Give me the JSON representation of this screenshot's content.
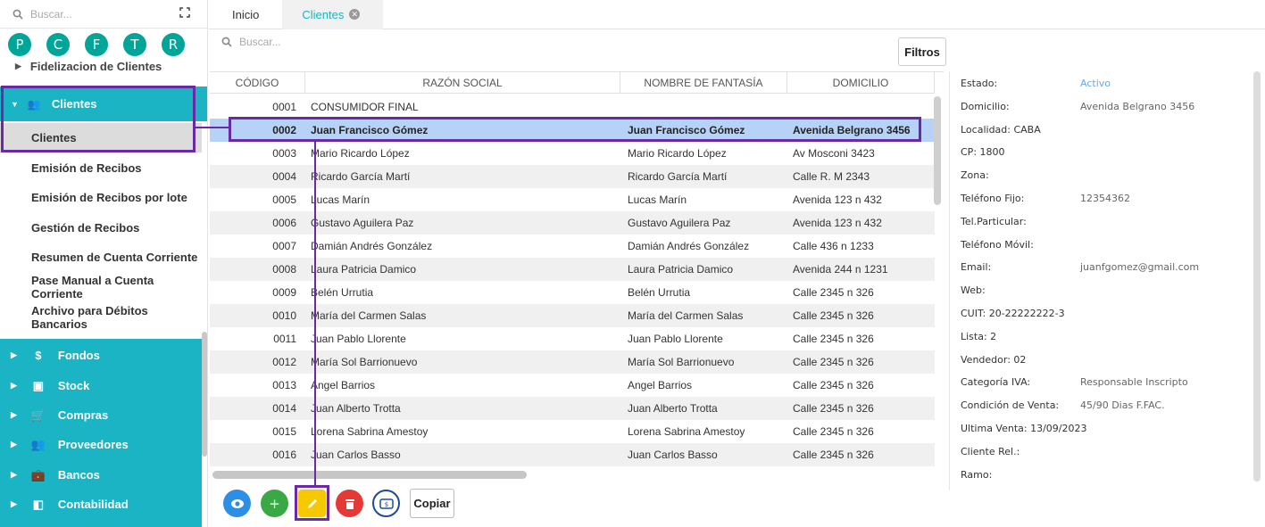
{
  "sidebar": {
    "search_placeholder": "Buscar...",
    "avatars": [
      "P",
      "C",
      "F",
      "T",
      "R"
    ],
    "above_item": "Fidelizacion de Clientes",
    "section": "Clientes",
    "sub_items": [
      "Clientes",
      "Emisión de Recibos",
      "Emisión de Recibos por lote",
      "Gestión de Recibos",
      "Resumen de Cuenta Corriente",
      "Pase Manual a Cuenta Corriente",
      "Archivo para Débitos Bancarios"
    ],
    "modules": [
      "Fondos",
      "Stock",
      "Compras",
      "Proveedores",
      "Bancos",
      "Contabilidad"
    ],
    "module_icons": [
      "$",
      "▣",
      "🛒",
      "👥",
      "💼",
      "◧"
    ]
  },
  "tabs": [
    "Inicio",
    "Clientes"
  ],
  "main": {
    "search_placeholder": "Buscar...",
    "filters_label": "Filtros",
    "columns": [
      "CÓDIGO",
      "RAZÓN SOCIAL",
      "NOMBRE DE FANTASÍA",
      "DOMICILIO"
    ],
    "rows": [
      [
        "0001",
        "CONSUMIDOR FINAL",
        "",
        ""
      ],
      [
        "0002",
        "Juan Francisco Gómez",
        "Juan Francisco Gómez",
        "Avenida Belgrano 3456"
      ],
      [
        "0003",
        "Mario Ricardo López",
        "Mario Ricardo López",
        "Av Mosconi 3423"
      ],
      [
        "0004",
        "Ricardo García Martí",
        "Ricardo García Martí",
        "Calle R. M 2343"
      ],
      [
        "0005",
        "Lucas Marín",
        "Lucas Marín",
        "Avenida 123 n 432"
      ],
      [
        "0006",
        "Gustavo Aguilera Paz",
        "Gustavo Aguilera Paz",
        "Avenida 123 n 432"
      ],
      [
        "0007",
        "Damián Andrés González",
        "Damián Andrés González",
        "Calle 436 n 1233"
      ],
      [
        "0008",
        "Laura Patricia Damico",
        "Laura Patricia Damico",
        "Avenida 244 n 1231"
      ],
      [
        "0009",
        "Belén Urrutia",
        "Belén Urrutia",
        "Calle 2345 n 326"
      ],
      [
        "0010",
        "María del Carmen Salas",
        "María del Carmen Salas",
        "Calle 2345 n 326"
      ],
      [
        "0011",
        "Juan Pablo Llorente",
        "Juan Pablo Llorente",
        "Calle 2345 n 326"
      ],
      [
        "0012",
        "María Sol Barrionuevo",
        "María Sol Barrionuevo",
        "Calle 2345 n 326"
      ],
      [
        "0013",
        "Angel Barrios",
        "Angel Barrios",
        "Calle 2345 n 326"
      ],
      [
        "0014",
        "Juan Alberto Trotta",
        "Juan Alberto Trotta",
        "Calle 2345 n 326"
      ],
      [
        "0015",
        "Lorena Sabrina Amestoy",
        "Lorena Sabrina Amestoy",
        "Calle 2345 n 326"
      ],
      [
        "0016",
        "Juan Carlos Basso",
        "Juan Carlos Basso",
        "Calle 2345 n 326"
      ]
    ],
    "selected_code": "0002"
  },
  "toolbar": {
    "copy_label": "Copiar",
    "colors": {
      "view": "#2d8ee6",
      "add": "#3aa845",
      "edit": "#f5c800",
      "delete": "#e53935",
      "receipt": "#1e4aa0"
    }
  },
  "details": [
    {
      "label": "Estado:",
      "value": "Activo"
    },
    {
      "label": "Domicilio:",
      "value": "Avenida Belgrano 3456"
    },
    {
      "label": "Localidad: CABA",
      "value": ""
    },
    {
      "label": "CP: 1800",
      "value": ""
    },
    {
      "label": "Zona:",
      "value": ""
    },
    {
      "label": "Teléfono Fijo:",
      "value": "12354362"
    },
    {
      "label": "Tel.Particular:",
      "value": ""
    },
    {
      "label": "Teléfono Móvil:",
      "value": ""
    },
    {
      "label": "Email:",
      "value": "juanfgomez@gmail.com"
    },
    {
      "label": "Web:",
      "value": ""
    },
    {
      "label": "CUIT: 20-22222222-3",
      "value": ""
    },
    {
      "label": "Lista: 2",
      "value": ""
    },
    {
      "label": "Vendedor: 02",
      "value": ""
    },
    {
      "label": "Categoría IVA:",
      "value": "Responsable Inscripto"
    },
    {
      "label": "Condición de Venta:",
      "value": "45/90 Dias F.FAC."
    },
    {
      "label": "Ultima Venta: 13/09/2023",
      "value": ""
    },
    {
      "label": "Cliente Rel.:",
      "value": ""
    },
    {
      "label": "Ramo:",
      "value": ""
    }
  ]
}
